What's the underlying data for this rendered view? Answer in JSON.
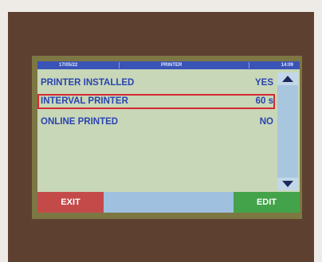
{
  "header": {
    "date": "17/05/22",
    "title": "PRINTER",
    "time": "14:09"
  },
  "rows": [
    {
      "label": "PRINTER INSTALLED",
      "value": "YES"
    },
    {
      "label": "INTERVAL PRINTER",
      "value": "60 s"
    },
    {
      "label": "ONLINE PRINTED",
      "value": "NO"
    }
  ],
  "footer": {
    "exit_label": "EXIT",
    "edit_label": "EDIT"
  },
  "colors": {
    "header_bar": "#3a53b6",
    "text": "#2a44b0",
    "selection_border": "#d42a32",
    "exit_button": "#c44a4a",
    "edit_button": "#43a34a"
  },
  "icons": {
    "scroll_up": "triangle-up",
    "scroll_down": "triangle-down"
  }
}
